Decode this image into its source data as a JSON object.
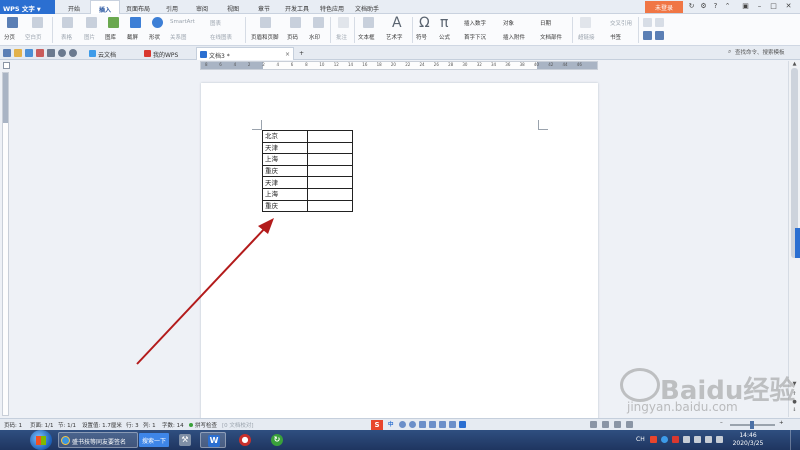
{
  "app": {
    "title": "WPS 文字"
  },
  "menu": {
    "tabs": [
      "开始",
      "插入",
      "页面布局",
      "引用",
      "审阅",
      "视图",
      "章节",
      "开发工具",
      "特色应用",
      "文档助手"
    ],
    "active_tab": "插入",
    "login_label": "未登录"
  },
  "ribbon": {
    "page_break": "分页",
    "blank_page": "空白页",
    "table": "表格",
    "picture": "图片",
    "gallery": "图库",
    "screenshot": "截屏",
    "shapes": "形状",
    "smartart": "SmartArt",
    "chart": "图表",
    "relation_chart": "关系图",
    "online_chart": "在线图表",
    "header_footer": "页眉和页脚",
    "page_number": "页码",
    "watermark": "水印",
    "comment": "批注",
    "text_box": "文本框",
    "word_art": "艺术字",
    "symbol": "符号",
    "formula": "公式",
    "insert_number": "插入数字",
    "first_drop": "首字下沉",
    "object": "对象",
    "attachment": "插入附件",
    "date": "日期",
    "doc_parts": "文档部件",
    "hyperlink": "超链接",
    "cross_reference": "交叉引用",
    "bookmark": "书签"
  },
  "tabbar": {
    "tabs": [
      {
        "label": "云文档"
      },
      {
        "label": "我的WPS"
      },
      {
        "label": "文档3 *"
      }
    ],
    "search_placeholder": "查找命令、搜索模板"
  },
  "ruler": {
    "ticks": [
      "8",
      "6",
      "4",
      "2",
      "2",
      "4",
      "6",
      "8",
      "10",
      "12",
      "14",
      "16",
      "18",
      "20",
      "22",
      "24",
      "26",
      "28",
      "30",
      "32",
      "34",
      "36",
      "38",
      "40",
      "42",
      "44",
      "46"
    ]
  },
  "document": {
    "table_rows": [
      [
        "北京",
        ""
      ],
      [
        "天津",
        ""
      ],
      [
        "上海",
        ""
      ],
      [
        "重庆",
        ""
      ],
      [
        "天津",
        ""
      ],
      [
        "上海",
        ""
      ],
      [
        "重庆",
        ""
      ]
    ]
  },
  "annotation": {
    "arrow_color": "#b31b1b"
  },
  "statusbar": {
    "page_number": "页码: 1",
    "pages": "页面: 1/1",
    "section": "节: 1/1",
    "position": "设置值: 1.7厘米",
    "row": "行: 3",
    "column": "列: 1",
    "word_count": "字数: 14",
    "spell_check": "拼写检查",
    "unit": "[0 文档校对]"
  },
  "ime": {
    "logo": "S",
    "mode": "中"
  },
  "taskbar": {
    "ie_task": "盛书技等同友要签名",
    "search_button": "搜索一下",
    "wps_letter": "W",
    "tray_language": "CH",
    "clock_time": "14:46",
    "clock_date": "2020/3/25"
  },
  "watermark": {
    "text": "Baidu经验",
    "sub": "jingyan.baidu.com"
  },
  "colors": {
    "accent": "#2b6fd1",
    "login": "#f07645",
    "ribbon_bg": "#fafbfd",
    "taskbar": "#1f3560"
  }
}
